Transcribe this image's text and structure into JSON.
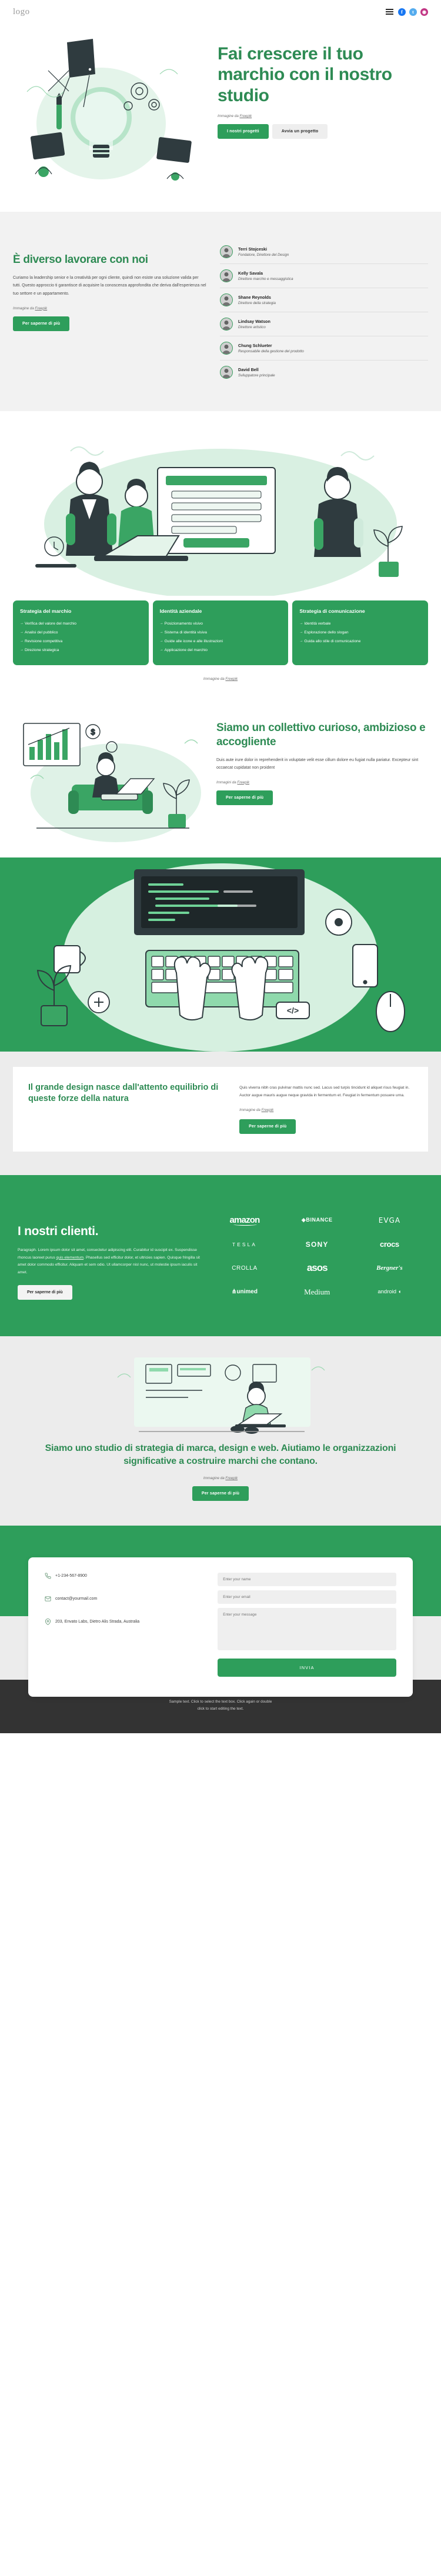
{
  "header": {
    "logo": "logo",
    "menu_icon": "hamburger-menu",
    "social": [
      {
        "name": "facebook",
        "glyph": "f"
      },
      {
        "name": "twitter",
        "glyph": "t"
      },
      {
        "name": "instagram",
        "glyph": "◉"
      }
    ]
  },
  "hero": {
    "title": "Fai crescere il tuo marchio con il nostro studio",
    "credit_prefix": "Immagine da ",
    "credit_link": "Freepik",
    "btn_primary": "I nostri progetti",
    "btn_secondary": "Avvia un progetto"
  },
  "team": {
    "title": "È diverso lavorare con noi",
    "body": "Curiamo la leadership senior e la creatività per ogni cliente, quindi non esiste una soluzione valida per tutti. Questo approccio ti garantisce di acquisire la conoscenza approfondita che deriva dall'esperienza nel tuo settore e un appartamento.",
    "credit_prefix": "Immagine da ",
    "credit_link": "Freepik",
    "button": "Per saperne di più",
    "members": [
      {
        "name": "Terri Stojceski",
        "role": "Fondatore, Direttore del Design"
      },
      {
        "name": "Kelly Savala",
        "role": "Direttore marchio e messaggistica"
      },
      {
        "name": "Shane Reynolds",
        "role": "Direttore della strategia"
      },
      {
        "name": "Lindsay Watson",
        "role": "Direttore artistico"
      },
      {
        "name": "Chung Schlueter",
        "role": "Responsabile della gestione del prodotto"
      },
      {
        "name": "David Bell",
        "role": "Sviluppatore principale"
      }
    ]
  },
  "cards": {
    "credit_prefix": "Immagine da ",
    "credit_link": "Freepik",
    "items": [
      {
        "title": "Strategia del marchio",
        "points": [
          "Verifica del valore del marchio",
          "Analisi del pubblico",
          "Revisione competitiva",
          "Direzione strategica"
        ]
      },
      {
        "title": "Identità aziendale",
        "points": [
          "Posizionamento visivo",
          "Sistema di identità visiva",
          "Guide alle icone e alle illustrazioni",
          "Applicazione del marchio"
        ]
      },
      {
        "title": "Strategia di comunicazione",
        "points": [
          "Identità verbale",
          "Esplorazione dello slogan",
          "Guida allo stile di comunicazione"
        ]
      }
    ]
  },
  "collettivo": {
    "title": "Siamo un collettivo curioso, ambizioso e accogliente",
    "body": "Duis aute irure dolor in reprehenderit in voluptate velit esse cillum dolore eu fugiat nulla pariatur. Excepteur sint occaecat cupidatat non proident",
    "credit_prefix": "Immagini da ",
    "credit_link": "Freepik",
    "button": "Per saperne di più"
  },
  "nasce": {
    "title": "Il grande design nasce dall'attento equilibrio di queste forze della natura",
    "body": "Quis viverra nibh cras pulvinar mattis nunc sed. Lacus sed turpis tincidunt id aliquet risus feugiat in. Auctor augue mauris augue neque gravida in fermentum et. Feugiat in fermentum posuere urna.",
    "credit_prefix": "Immagine da ",
    "credit_link": "Freepik",
    "button": "Per saperne di più"
  },
  "clienti": {
    "title": "I nostri clienti.",
    "body_1": "Paragraph. Lorem ipsum dolor sit amet, consectetur adipiscing elit. Curabitur id suscipit ex. Suspendisse rhoncus laoreet purus ",
    "body_link": "quis elementum",
    "body_2": ". Phasellus sed efficitur dolor, et ultricies sapien. Quisque fringilla sit amet dolor commodo efficitur. Aliquam et sem odio. Ut ullamcorper nisl nunc, ut molestie ipsum iaculis sit amet.",
    "button": "Per saperne di più",
    "brands": [
      "amazon",
      "BINANCE",
      "EVGA",
      "TESLA",
      "SONY",
      "crocs",
      "CROLLA",
      "asos",
      "Bergner's",
      "unimed",
      "Medium",
      "android"
    ]
  },
  "studio": {
    "title": "Siamo uno studio di strategia di marca, design e web. Aiutiamo le organizzazioni significative a costruire marchi che contano.",
    "credit_prefix": "Immagine da ",
    "credit_link": "Freepik",
    "button": "Per saperne di più"
  },
  "contact": {
    "phone": "+1-234-567-8900",
    "email": "contact@yourmail.com",
    "address": "203, Envato Labs, Dietro Alis Strada, Australia",
    "name_placeholder": "Enter your name",
    "email_placeholder": "Enter your email",
    "message_placeholder": "Enter your message",
    "send_label": "INVIA",
    "phone_icon": "phone-icon",
    "email_icon": "envelope-icon",
    "address_icon": "map-pin-icon"
  },
  "footer": {
    "line1": "Sample text. Click to select the text box. Click again or double",
    "line2": "click to start editing the text."
  },
  "colors": {
    "green": "#2e9e5b",
    "green_dark": "#2e8b54",
    "grey_bg": "#f2f2f2",
    "grey_bg2": "#ececec",
    "footer_bg": "#333333"
  }
}
